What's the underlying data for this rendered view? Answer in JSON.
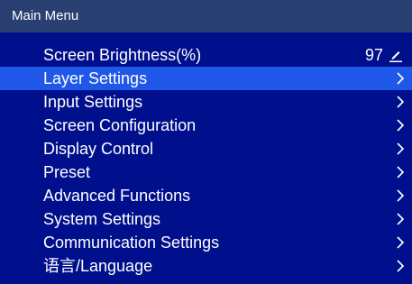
{
  "header": {
    "title": "Main Menu"
  },
  "menu": {
    "items": [
      {
        "label": "Screen Brightness(%)",
        "value": "97",
        "icon": "edit-icon"
      },
      {
        "label": "Layer Settings",
        "icon": "chevron-right-icon",
        "selected": true
      },
      {
        "label": "Input Settings",
        "icon": "chevron-right-icon"
      },
      {
        "label": "Screen Configuration",
        "icon": "chevron-right-icon"
      },
      {
        "label": "Display Control",
        "icon": "chevron-right-icon"
      },
      {
        "label": "Preset",
        "icon": "chevron-right-icon"
      },
      {
        "label": "Advanced Functions",
        "icon": "chevron-right-icon"
      },
      {
        "label": "System Settings",
        "icon": "chevron-right-icon"
      },
      {
        "label": "Communication Settings",
        "icon": "chevron-right-icon"
      },
      {
        "label": "语言/Language",
        "icon": "chevron-right-icon"
      }
    ]
  },
  "colors": {
    "title_bar": "#2a3f72",
    "menu_background": "#000f8c",
    "selected_row": "#1f57e8",
    "text": "#ffffff"
  }
}
